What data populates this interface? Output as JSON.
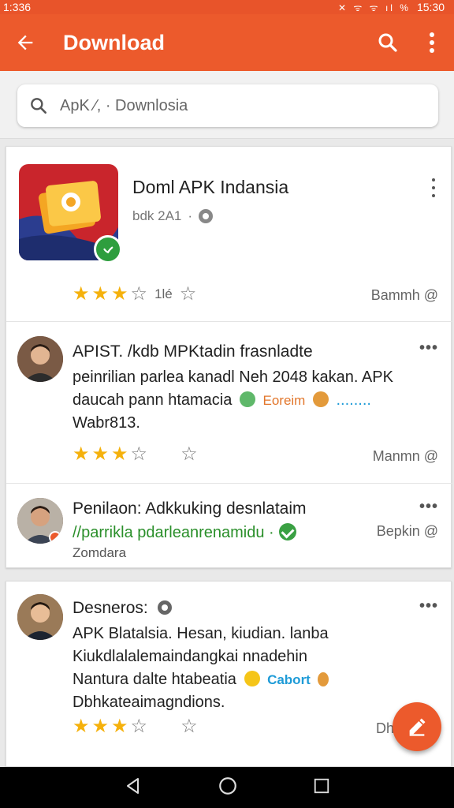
{
  "status_bar": {
    "time_left": "1:336",
    "time_right": "15:30",
    "icons": "✕ ᯤ ᯤ ıl %"
  },
  "app_bar": {
    "title": "Download"
  },
  "search": {
    "value": "ApK ⁄, · Downlosia",
    "placeholder": ""
  },
  "app_card": {
    "name": "Doml APK Indansia",
    "subtitle": "bdk 2A1",
    "rating_stars": 3,
    "rating_count": "1lé",
    "right_label": "Bammh @"
  },
  "reviews": [
    {
      "title": "APIST. /kdb MPKtadin frasnladte",
      "line1": "peinrilian parlea kanadl Neh 2048 kakan. APK",
      "line2_text": "daucah pann htamacia",
      "line2_tag": "Eoreim",
      "line2_dots": "........",
      "line3": "Wabr813.",
      "rating_stars": 3,
      "right_label": "Manmn @",
      "menu": "•••"
    },
    {
      "title": "Penilaon: Adkkuking desnlataim",
      "line1": "//parrikla pdarleanrenamidu ·",
      "line2": "Zomdara",
      "right_label": "Bepkin @",
      "menu": "•••"
    },
    {
      "title": "Desneros:",
      "line1": "APK Blatalsia. Hesan, kiudian. lanba",
      "line2": "Kiukdlalalemaindangkai nnadehin",
      "line3_text": "Nantura dalte htabeatia",
      "line3_tag": "Cabort",
      "line4": "Dbhkateaimagndions.",
      "rating_stars": 3,
      "right_label": "Dh",
      "menu": "•••"
    }
  ],
  "colors": {
    "primary": "#ec5a2c",
    "star": "#f5b10c",
    "verified": "#2e9e3e"
  },
  "icons": [
    "back-arrow-icon",
    "search-icon",
    "more-vert-icon",
    "verified-icon",
    "star-icon",
    "edit-icon",
    "nav-back-icon",
    "nav-home-icon",
    "nav-recents-icon"
  ]
}
